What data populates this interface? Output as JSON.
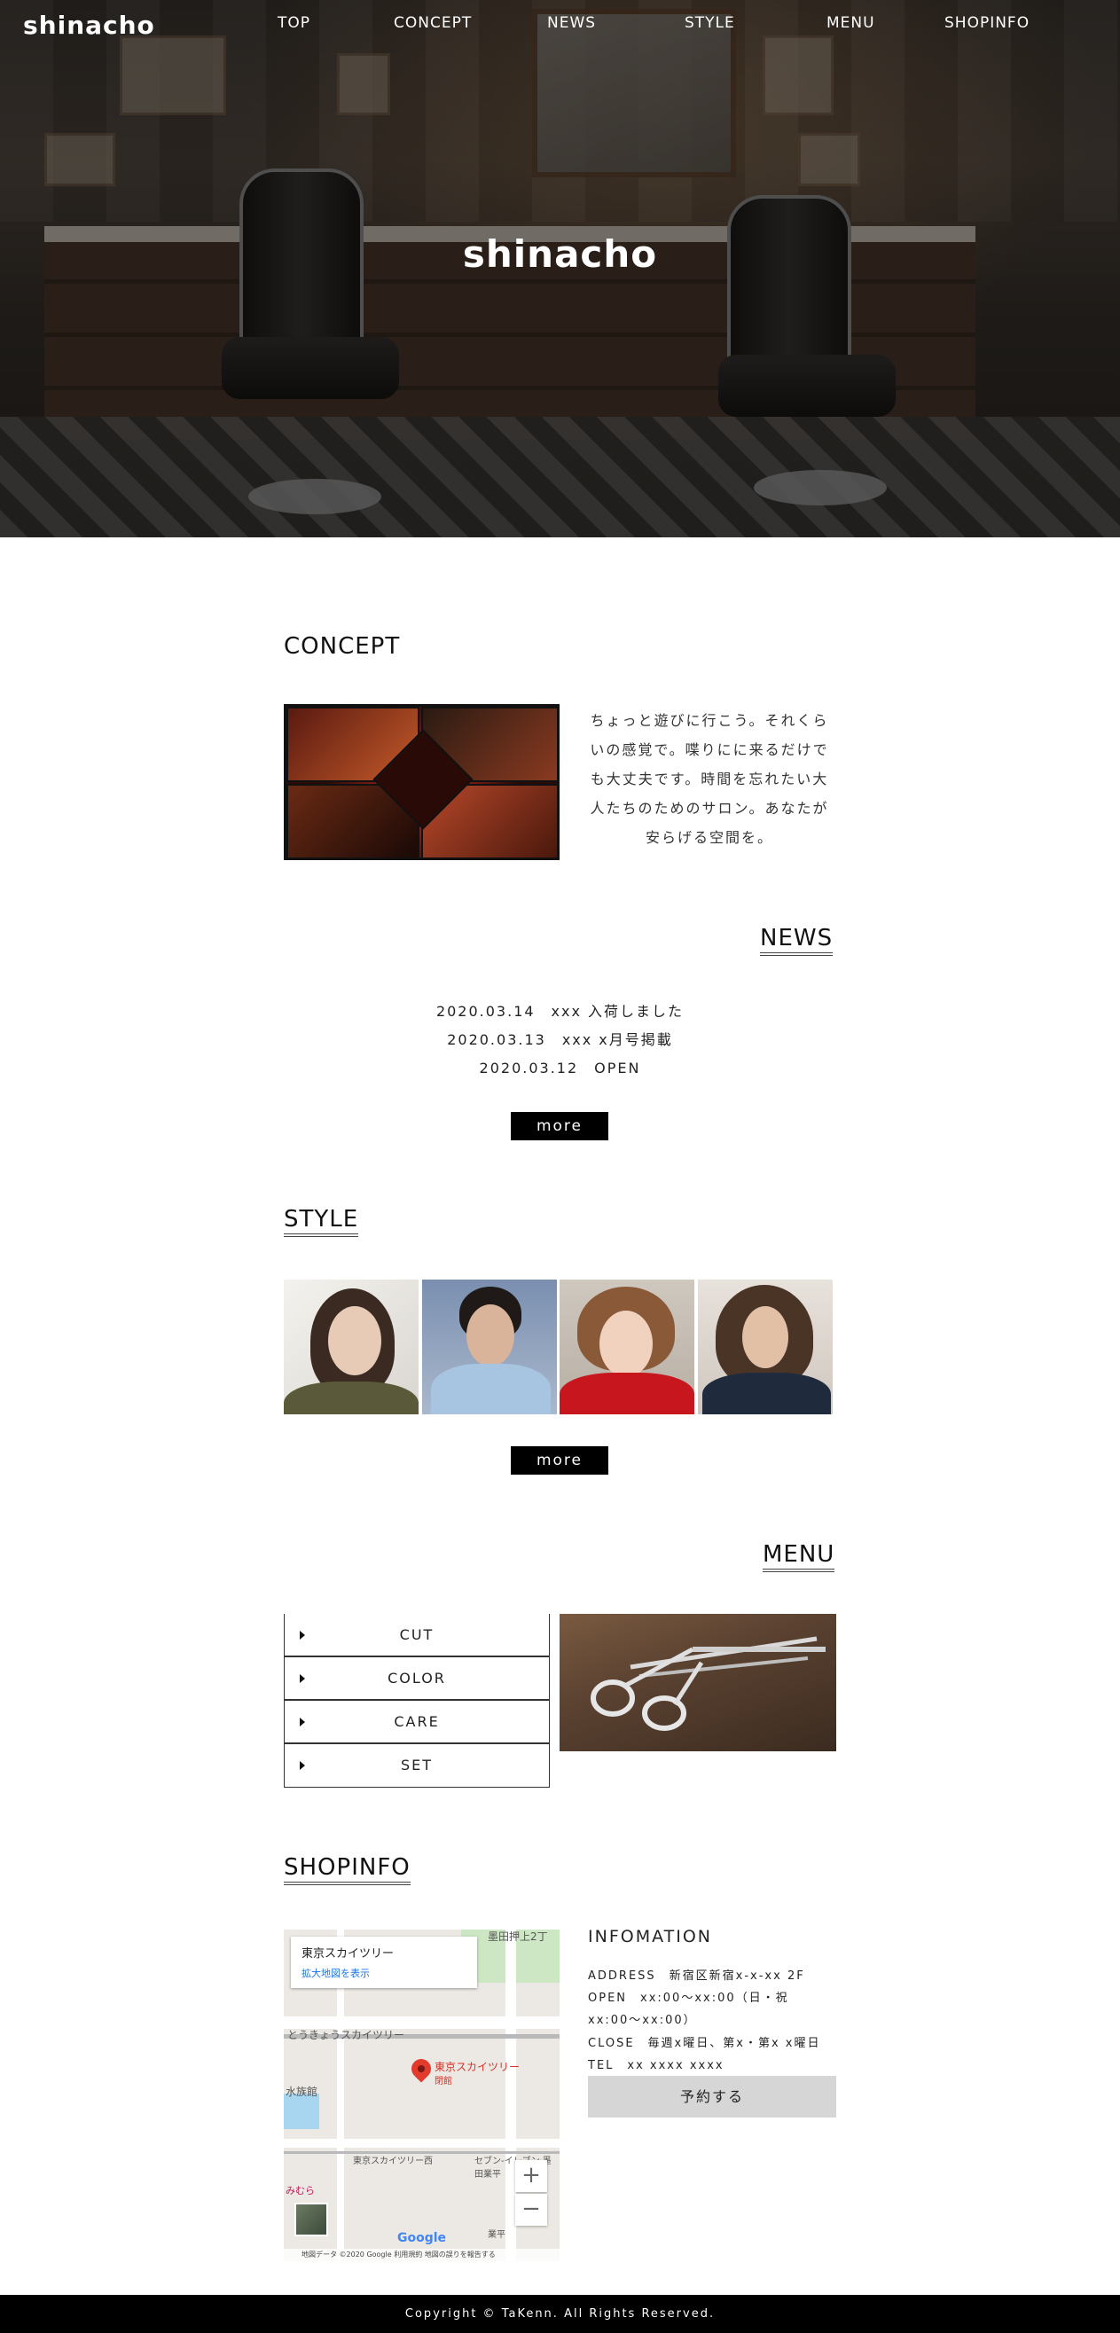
{
  "header": {
    "logo": "shinacho",
    "nav": [
      "TOP",
      "CONCEPT",
      "NEWS",
      "STYLE",
      "MENU",
      "SHOPINFO"
    ]
  },
  "hero": {
    "title": "shinacho"
  },
  "concept": {
    "heading": "CONCEPT",
    "text_lines": [
      "ちょっと遊びに行こう。それくら",
      "いの感覚で。喋りにに来るだけで",
      "も大丈夫です。時間を忘れたい大",
      "人たちのためのサロン。あなたが",
      "安らげる空間を。"
    ]
  },
  "news": {
    "heading": "NEWS",
    "items": [
      {
        "date": "2020.03.14",
        "text": "xxx 入荷しました"
      },
      {
        "date": "2020.03.13",
        "text": "xxx x月号掲載"
      },
      {
        "date": "2020.03.12",
        "text": "OPEN"
      }
    ],
    "more": "more"
  },
  "style": {
    "heading": "STYLE",
    "more": "more"
  },
  "menu": {
    "heading": "MENU",
    "items": [
      "CUT",
      "COLOR",
      "CARE",
      "SET"
    ]
  },
  "shopinfo": {
    "heading": "SHOPINFO",
    "map": {
      "place_name": "東京スカイツリー",
      "larger_map": "拡大地図を表示",
      "pin_label": "東京スカイツリー",
      "pin_sublabel": "閉館",
      "labels": [
        "墨田押上2丁",
        "とうきょうスカイツリー",
        "水族館",
        "東京スカイツリー西",
        "セブン-イレブン 墨田業平",
        "みむら",
        "業平"
      ],
      "footer": "地図データ ©2020 Google   利用規約   地図の誤りを報告する",
      "google": "Google",
      "zoom_in": "+",
      "zoom_out": "−"
    },
    "info_title": "INFOMATION",
    "address": "ADDRESS　新宿区新宿x-x-xx 2F",
    "open_line1": "OPEN　xx:00〜xx:00（日・祝",
    "open_line2": "xx:00〜xx:00）",
    "close": "CLOSE　毎週x曜日、第x・第x x曜日",
    "tel": "TEL　xx xxxx xxxx",
    "reserve": "予約する"
  },
  "footer": {
    "copyright": "Copyright © TaKenn. All Rights Reserved."
  }
}
